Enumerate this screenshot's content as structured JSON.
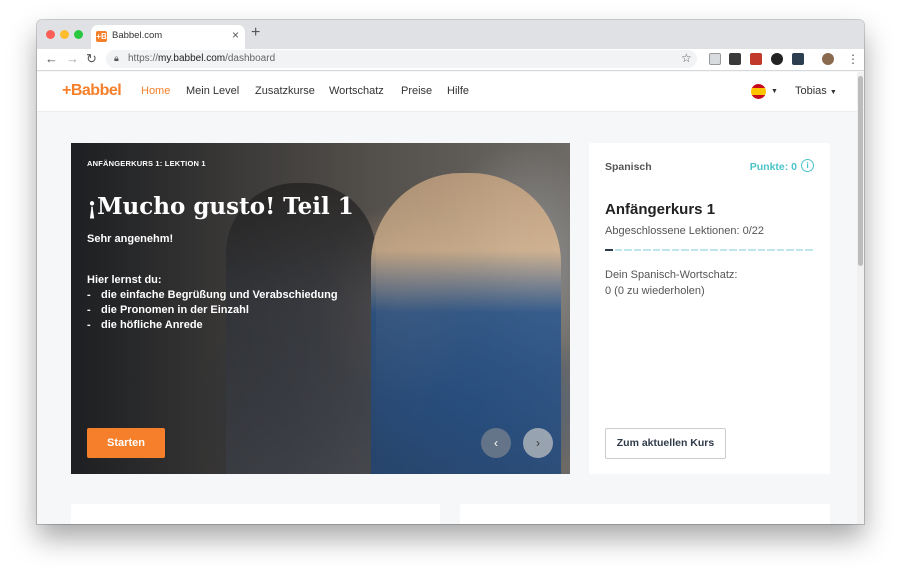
{
  "browser": {
    "tab_title": "Babbel.com",
    "tab_favicon": "+B",
    "url_scheme": "https://",
    "url_host": "my.babbel.com",
    "url_path": "/dashboard"
  },
  "site": {
    "logo": "+Babbel",
    "nav": [
      "Home",
      "Mein Level",
      "Zusatzkurse",
      "Wortschatz",
      "Preise",
      "Hilfe"
    ],
    "active_nav": "Home",
    "user": "Tobias",
    "flag": "spain-flag-icon"
  },
  "hero": {
    "kicker": "ANFÄNGERKURS 1: LEKTION 1",
    "title": "¡Mucho gusto! Teil 1",
    "subtitle": "Sehr angenehm!",
    "learn_heading": "Hier lernst du:",
    "learn_items": [
      "die einfache Begrüßung und Verabschiedung",
      "die Pronomen in der Einzahl",
      "die höfliche Anrede"
    ],
    "start_button": "Starten"
  },
  "course_card": {
    "language": "Spanisch",
    "points_label": "Punkte: 0",
    "course_title": "Anfängerkurs 1",
    "completed_lessons": "Abgeschlossene Lektionen: 0/22",
    "progress_completed": 0,
    "progress_total": 22,
    "vocab_label": "Dein Spanisch-Wortschatz:",
    "vocab_value": "0 (0 zu wiederholen)",
    "current_course_button": "Zum aktuellen Kurs"
  },
  "colors": {
    "brand_orange": "#f57f2a",
    "points_teal": "#4bc3c9",
    "progress_empty": "#bfe6ea",
    "progress_marker": "#2f3a4a"
  }
}
